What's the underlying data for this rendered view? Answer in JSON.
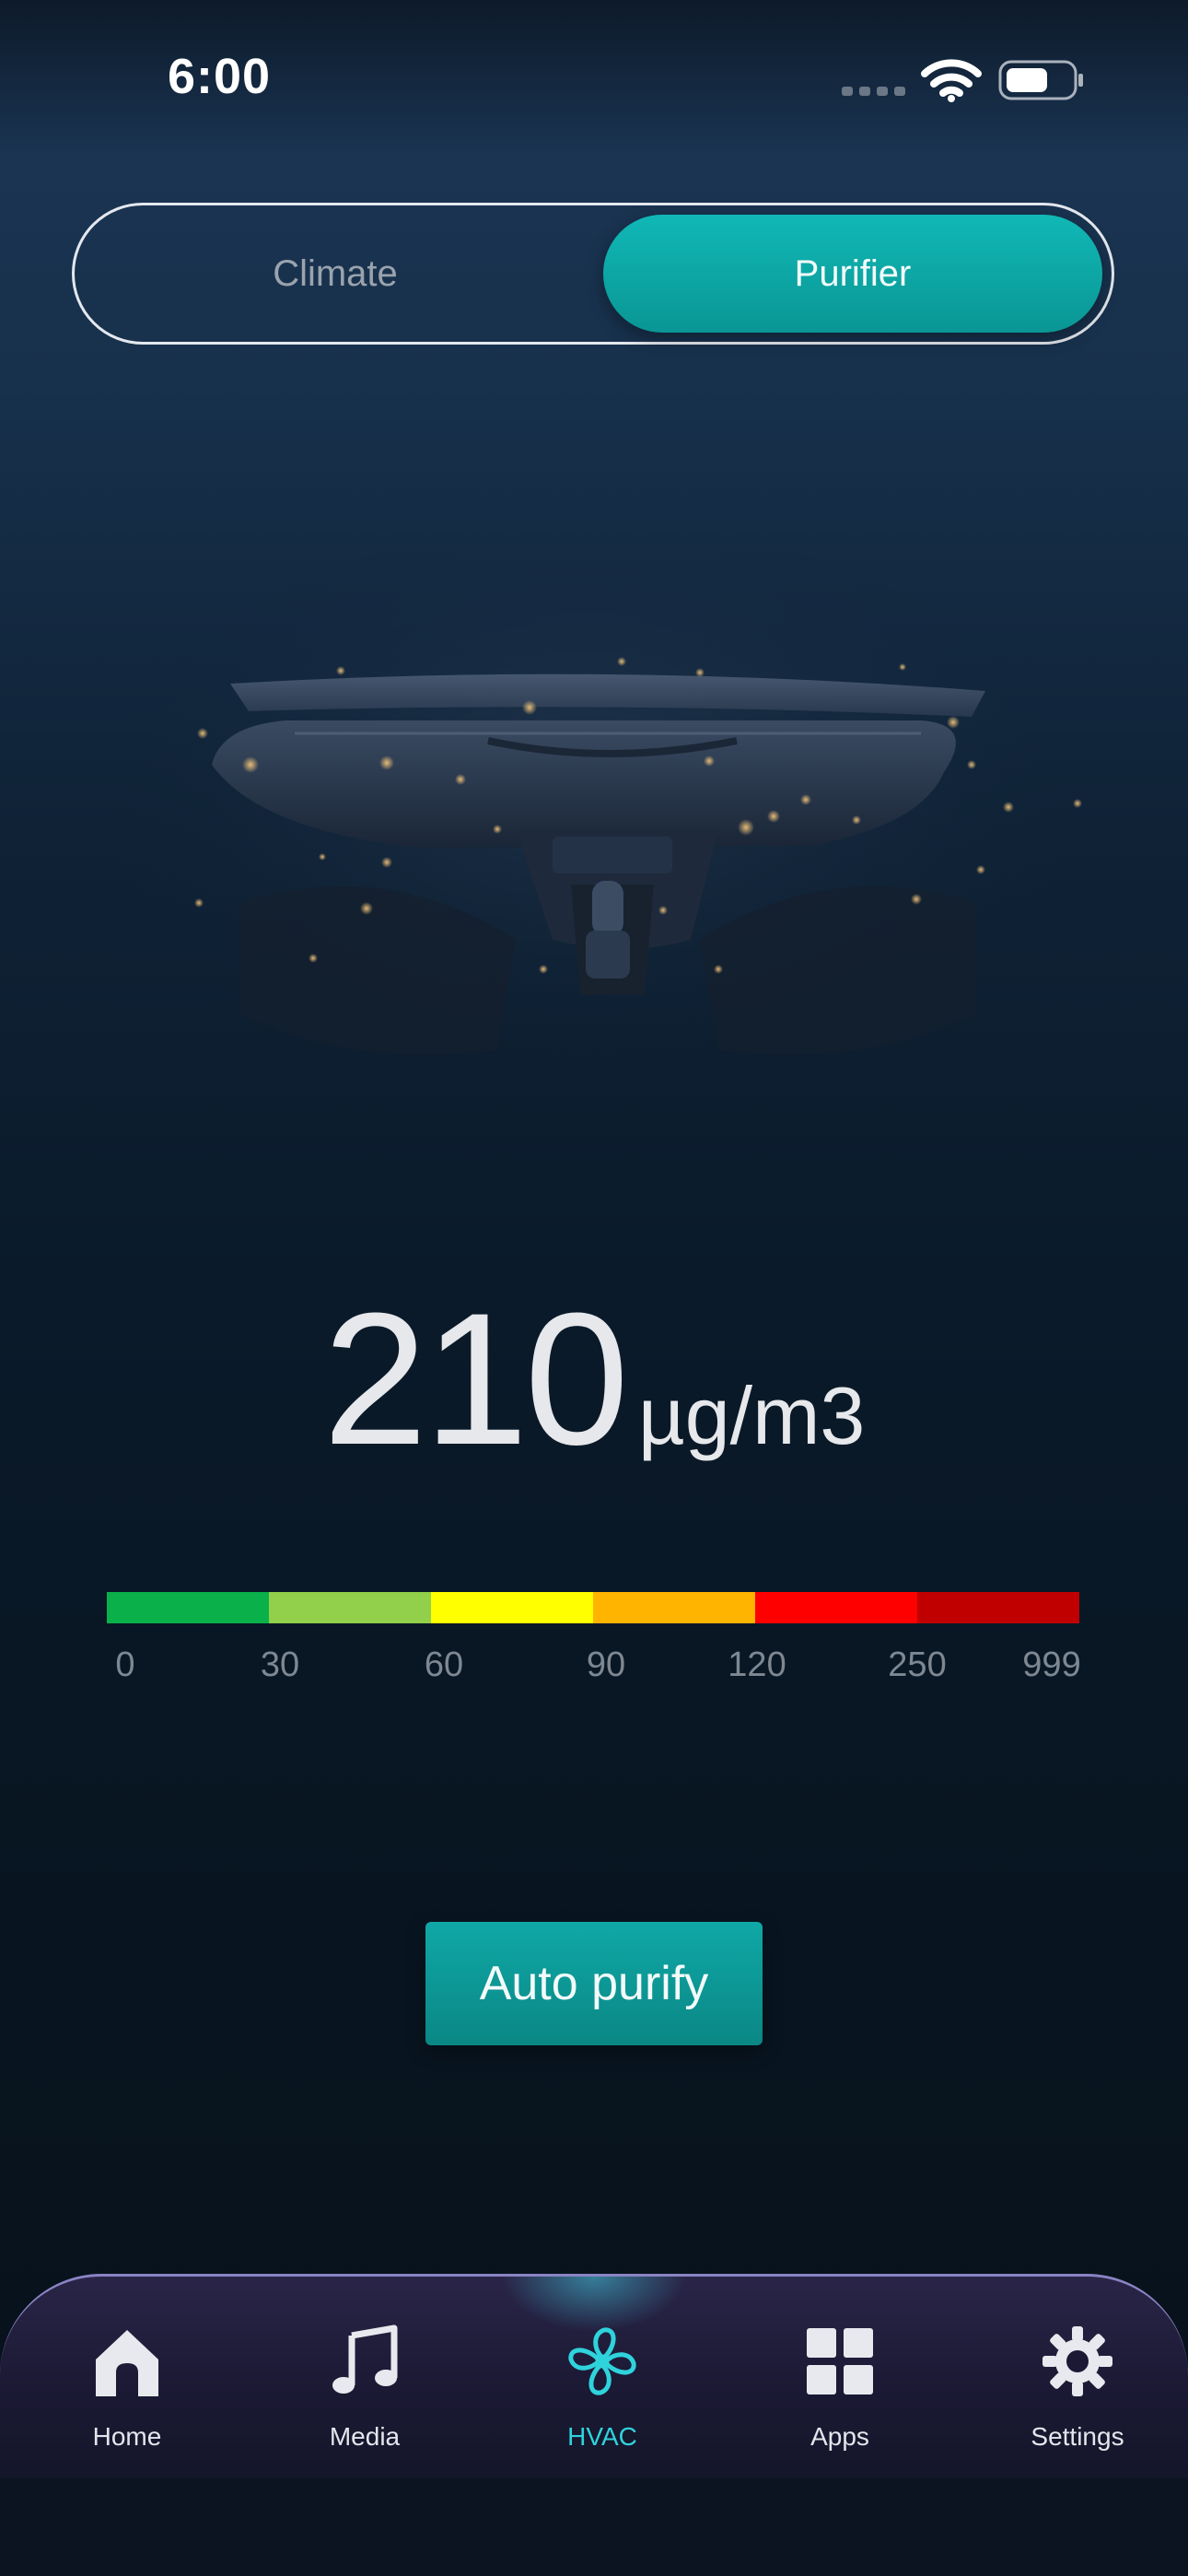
{
  "status_bar": {
    "time": "6:00",
    "battery_icon": "battery-icon",
    "wifi_icon": "wifi-icon"
  },
  "tabs": [
    {
      "label": "Climate",
      "active": false
    },
    {
      "label": "Purifier",
      "active": true
    }
  ],
  "reading": {
    "value": "210",
    "unit": "µg/m3"
  },
  "scale": {
    "colors": [
      "#0ab04a",
      "#92cf4a",
      "#ffff00",
      "#ffb400",
      "#ff0000",
      "#c00000"
    ],
    "labels": [
      "0",
      "30",
      "60",
      "90",
      "120",
      "250",
      "999"
    ]
  },
  "action": {
    "label": "Auto purify"
  },
  "nav": [
    {
      "label": "Home",
      "icon": "home-icon",
      "active": false
    },
    {
      "label": "Media",
      "icon": "music-note-icon",
      "active": false
    },
    {
      "label": "HVAC",
      "icon": "fan-icon",
      "active": true
    },
    {
      "label": "Apps",
      "icon": "apps-grid-icon",
      "active": false
    },
    {
      "label": "Settings",
      "icon": "gear-icon",
      "active": false
    }
  ],
  "colors": {
    "accent": "#0fa8a6",
    "nav_active": "#2fd3dc"
  }
}
